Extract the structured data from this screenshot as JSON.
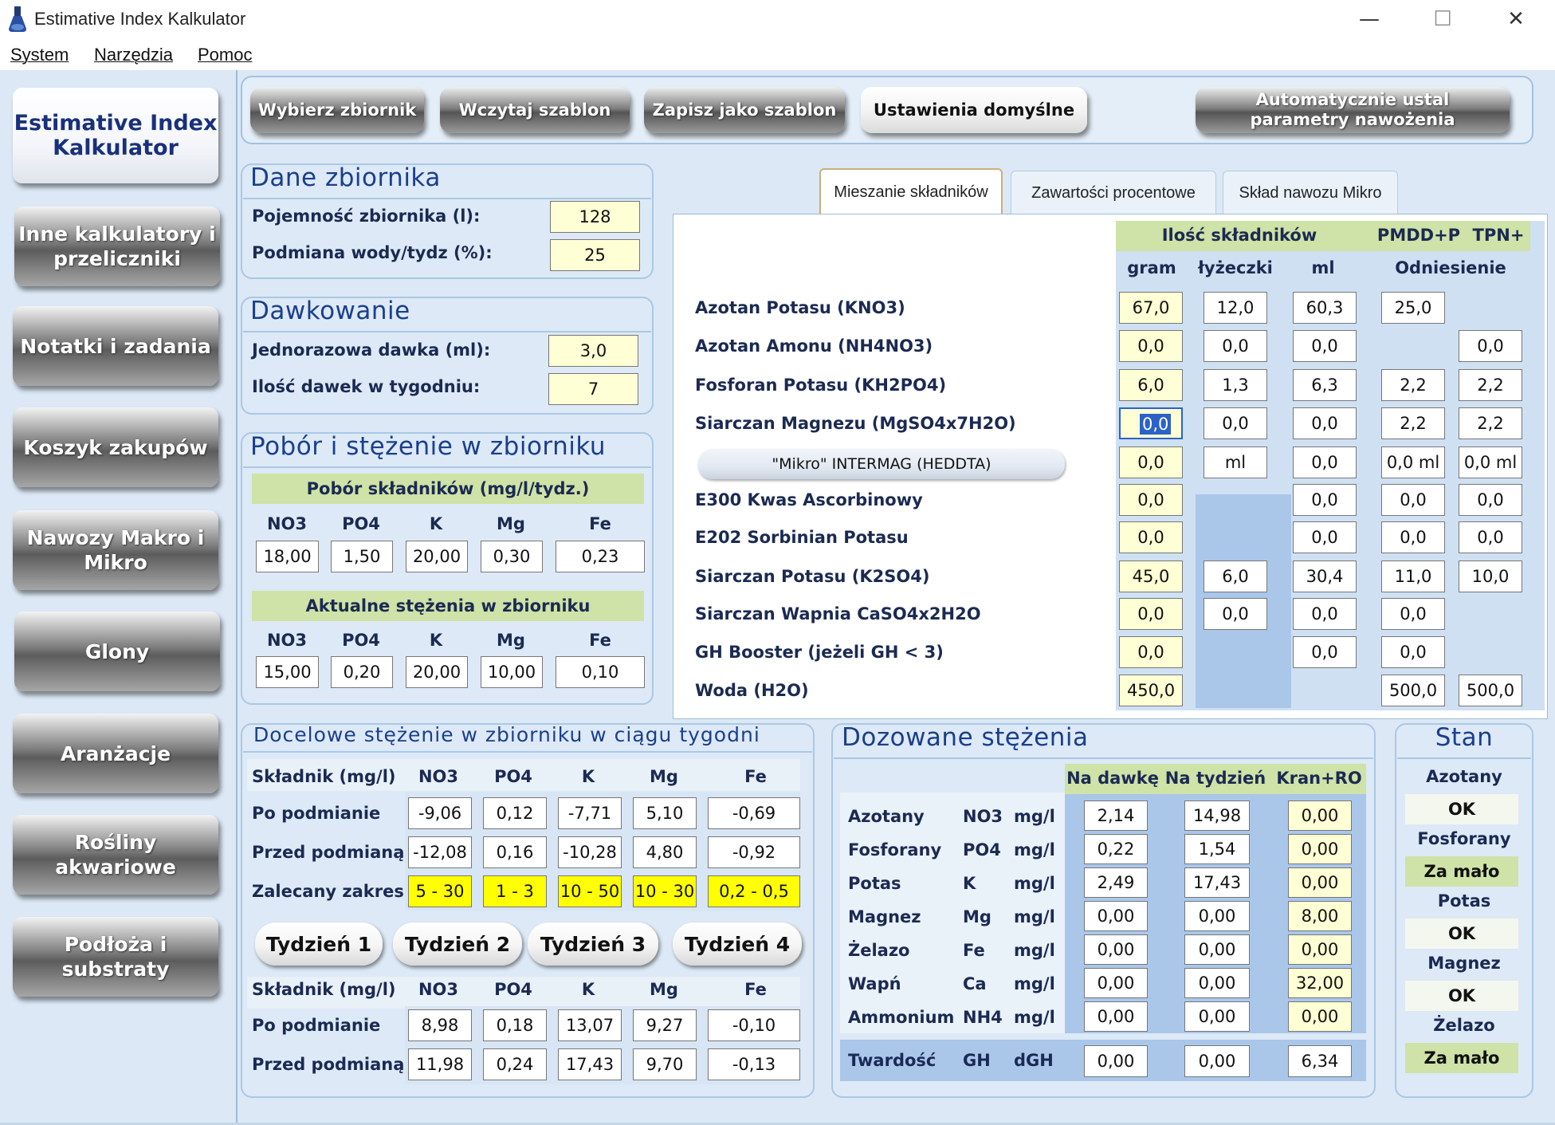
{
  "window": {
    "title": "Estimative Index Kalkulator",
    "minimize": "—",
    "maximize": "☐",
    "close": "✕"
  },
  "menu": [
    "System",
    "Narzędzia",
    "Pomoc"
  ],
  "sidebar": [
    "Estimative Index Kalkulator",
    "Inne kalkulatory i przeliczniki",
    "Notatki i zadania",
    "Koszyk zakupów",
    "Nawozy Makro i Mikro",
    "Glony",
    "Aranżacje",
    "Rośliny akwariowe",
    "Podłoża i substraty"
  ],
  "toolbar": {
    "select_tank": "Wybierz zbiornik",
    "load_template": "Wczytaj szablon",
    "save_template": "Zapisz jako szablon",
    "defaults": "Ustawienia domyślne",
    "auto": "Automatycznie ustal parametry nawożenia"
  },
  "tank": {
    "title": "Dane zbiornika",
    "capacity_label": "Pojemność zbiornika (l):",
    "capacity": "128",
    "water_change_label": "Podmiana wody/tydz (%):",
    "water_change": "25"
  },
  "dosing": {
    "title": "Dawkowanie",
    "dose_label": "Jednorazowa dawka (ml):",
    "dose": "3,0",
    "count_label": "Ilość dawek w tygodniu:",
    "count": "7"
  },
  "uptake": {
    "title": "Pobór i stężenie w zbiorniku",
    "uptake_header": "Pobór składników (mg/l/tydz.)",
    "columns": [
      "NO3",
      "PO4",
      "K",
      "Mg",
      "Fe"
    ],
    "uptake_values": [
      "18,00",
      "1,50",
      "20,00",
      "0,30",
      "0,23"
    ],
    "current_header": "Aktualne stężenia w zbiorniku",
    "current_values": [
      "15,00",
      "0,20",
      "20,00",
      "10,00",
      "0,10"
    ]
  },
  "tabs": [
    "Mieszanie składników",
    "Zawartości procentowe",
    "Skład nawozu Mikro"
  ],
  "mix": {
    "group_header": "Ilość składników",
    "pmdd": "PMDD+P",
    "tpn": "TPN+",
    "col_gram": "gram",
    "col_spoon": "łyżeczki",
    "col_ml": "ml",
    "col_ref": "Odniesienie",
    "rows": [
      {
        "name": "Azotan Potasu (KNO3)",
        "gram": "67,0",
        "spoon": "12,0",
        "ml": "60,3",
        "pmdd": "25,0",
        "tpn": ""
      },
      {
        "name": "Azotan Amonu (NH4NO3)",
        "gram": "0,0",
        "spoon": "0,0",
        "ml": "0,0",
        "pmdd": "",
        "tpn": "0,0"
      },
      {
        "name": "Fosforan Potasu (KH2PO4)",
        "gram": "6,0",
        "spoon": "1,3",
        "ml": "6,3",
        "pmdd": "2,2",
        "tpn": "2,2"
      },
      {
        "name": "Siarczan Magnezu (MgSO4x7H2O)",
        "gram": "0,0",
        "spoon": "0,0",
        "ml": "0,0",
        "pmdd": "2,2",
        "tpn": "2,2"
      },
      {
        "name": "\"Mikro\" INTERMAG (HEDDTA)",
        "gram": "0,0",
        "spoon": "ml",
        "ml": "0,0",
        "pmdd": "0,0 ml",
        "tpn": "0,0 ml"
      },
      {
        "name": "E300 Kwas Ascorbinowy",
        "gram": "0,0",
        "spoon": "",
        "ml": "0,0",
        "pmdd": "0,0",
        "tpn": "0,0"
      },
      {
        "name": "E202 Sorbinian Potasu",
        "gram": "0,0",
        "spoon": "",
        "ml": "0,0",
        "pmdd": "0,0",
        "tpn": "0,0"
      },
      {
        "name": "Siarczan Potasu (K2SO4)",
        "gram": "45,0",
        "spoon": "6,0",
        "ml": "30,4",
        "pmdd": "11,0",
        "tpn": "10,0"
      },
      {
        "name": "Siarczan Wapnia CaSO4x2H2O",
        "gram": "0,0",
        "spoon": "0,0",
        "ml": "0,0",
        "pmdd": "0,0",
        "tpn": ""
      },
      {
        "name": "GH Booster (jeżeli GH < 3)",
        "gram": "0,0",
        "spoon": "",
        "ml": "0,0",
        "pmdd": "0,0",
        "tpn": ""
      },
      {
        "name": "Woda (H2O)",
        "gram": "450,0",
        "spoon": "",
        "ml": "",
        "pmdd": "500,0",
        "tpn": "500,0"
      }
    ]
  },
  "target": {
    "title": "Docelowe stężenie w zbiorniku w ciągu tygodni",
    "col_label": "Składnik (mg/l)",
    "columns": [
      "NO3",
      "PO4",
      "K",
      "Mg",
      "Fe"
    ],
    "after_label": "Po podmianie",
    "after": [
      "-9,06",
      "0,12",
      "-7,71",
      "5,10",
      "-0,69"
    ],
    "before_label": "Przed podmianą",
    "before": [
      "-12,08",
      "0,16",
      "-10,28",
      "4,80",
      "-0,92"
    ],
    "range_label": "Zalecany zakres",
    "range": [
      "5 - 30",
      "1 - 3",
      "10 - 50",
      "10 - 30",
      "0,2 - 0,5"
    ],
    "weeks": [
      "Tydzień 1",
      "Tydzień 2",
      "Tydzień 3",
      "Tydzień 4"
    ],
    "week": {
      "after": [
        "8,98",
        "0,18",
        "13,07",
        "9,27",
        "-0,10"
      ],
      "before": [
        "11,98",
        "0,24",
        "17,43",
        "9,70",
        "-0,13"
      ]
    }
  },
  "dosed": {
    "title": "Dozowane stężenia",
    "col_dose": "Na dawkę",
    "col_week": "Na tydzień",
    "col_tap": "Kran+RO",
    "rows": [
      {
        "name": "Azotany",
        "sym": "NO3",
        "unit": "mg/l",
        "dose": "2,14",
        "week": "14,98",
        "tap": "0,00"
      },
      {
        "name": "Fosforany",
        "sym": "PO4",
        "unit": "mg/l",
        "dose": "0,22",
        "week": "1,54",
        "tap": "0,00"
      },
      {
        "name": "Potas",
        "sym": "K",
        "unit": "mg/l",
        "dose": "2,49",
        "week": "17,43",
        "tap": "0,00"
      },
      {
        "name": "Magnez",
        "sym": "Mg",
        "unit": "mg/l",
        "dose": "0,00",
        "week": "0,00",
        "tap": "8,00"
      },
      {
        "name": "Żelazo",
        "sym": "Fe",
        "unit": "mg/l",
        "dose": "0,00",
        "week": "0,00",
        "tap": "0,00"
      },
      {
        "name": "Wapń",
        "sym": "Ca",
        "unit": "mg/l",
        "dose": "0,00",
        "week": "0,00",
        "tap": "32,00"
      },
      {
        "name": "Ammonium",
        "sym": "NH4",
        "unit": "mg/l",
        "dose": "0,00",
        "week": "0,00",
        "tap": "0,00"
      }
    ],
    "hardness": {
      "name": "Twardość",
      "sym": "GH",
      "unit": "dGH",
      "dose": "0,00",
      "week": "0,00",
      "tap": "6,34"
    }
  },
  "stan": {
    "title": "Stan",
    "items": [
      {
        "label": "Azotany",
        "value": "OK",
        "color": "#f4f7ee"
      },
      {
        "label": "Fosforany",
        "value": "Za mało",
        "color": "#cfe2a7"
      },
      {
        "label": "Potas",
        "value": "OK",
        "color": "#f4f7ee"
      },
      {
        "label": "Magnez",
        "value": "OK",
        "color": "#f4f7ee"
      },
      {
        "label": "Żelazo",
        "value": "Za mało",
        "color": "#cfe2a7"
      }
    ]
  }
}
